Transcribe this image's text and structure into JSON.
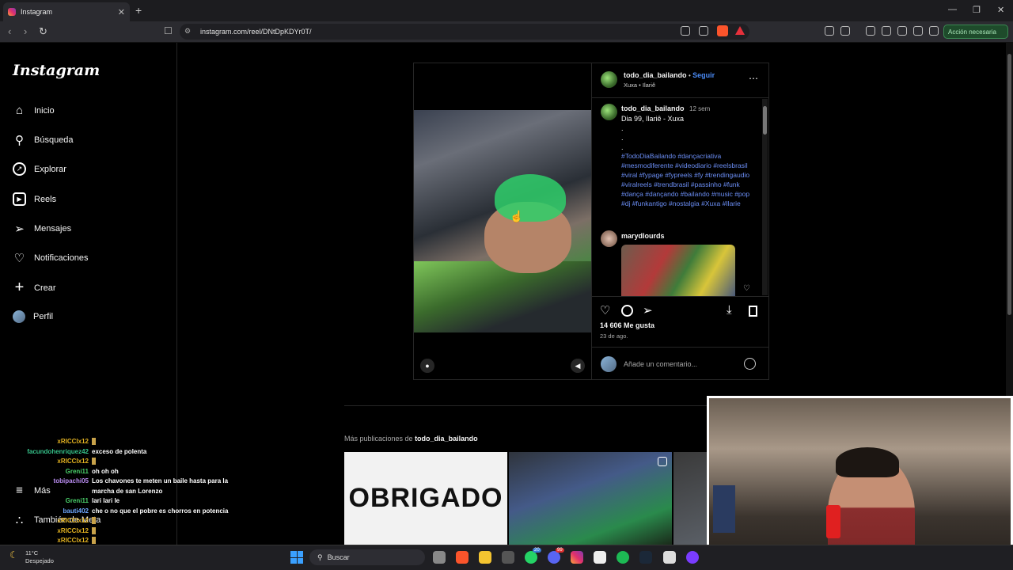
{
  "browser": {
    "tab_title": "Instagram",
    "url": "instagram.com/reel/DNtDpKDYr0T/",
    "action_button": "Acción necesaria",
    "new_tab": "+",
    "tab_close": "✕",
    "win_min": "—",
    "win_max": "❐",
    "win_close": "✕"
  },
  "sidebar": {
    "logo": "Instagram",
    "items": [
      {
        "label": "Inicio",
        "icon": "home-icon"
      },
      {
        "label": "Búsqueda",
        "icon": "search-icon"
      },
      {
        "label": "Explorar",
        "icon": "compass-icon"
      },
      {
        "label": "Reels",
        "icon": "reels-icon"
      },
      {
        "label": "Mensajes",
        "icon": "send-icon"
      },
      {
        "label": "Notificaciones",
        "icon": "heart-icon"
      },
      {
        "label": "Crear",
        "icon": "plus-icon"
      },
      {
        "label": "Perfil",
        "icon": "avatar-icon"
      }
    ],
    "more": "Más",
    "meta": "También de Meta"
  },
  "post": {
    "author": "todo_dia_bailando",
    "follow": "Seguir",
    "audio": "Xuxa • Ilariê",
    "caption_author": "todo_dia_bailando",
    "caption_time": "12 sem",
    "caption_text": "Dia 99, Ilariê - Xuxa",
    "dot1": ".",
    "dot2": ".",
    "dot3": ".",
    "hashtags": "#TodoDiaBailando #dançacriativa #mesmodiferente #videodiario #reelsbrasil #viral #fypage #fypreels #fy #trendingaudio #viralreels #trendbrasil #passinho #funk #dança #dançando #bailando #music #pop #dj #funkantigo #nostalgia #Xuxa #Ilarie",
    "comment_user": "marydlourds",
    "likes": "14 606 Me gusta",
    "date": "23 de ago.",
    "comment_placeholder": "Añade un comentario..."
  },
  "more_posts": {
    "label_prefix": "Más publicaciones de ",
    "label_user": "todo_dia_bailando",
    "first_text": "OBRIGADO"
  },
  "chat": [
    {
      "user": "xRICCIx12",
      "msg": "",
      "color": "#e0b020",
      "emote": true
    },
    {
      "user": "facundohenriquez42",
      "msg": "exceso de polenta",
      "color": "#36c28a",
      "emote": false
    },
    {
      "user": "xRICCIx12",
      "msg": "",
      "color": "#e0b020",
      "emote": true
    },
    {
      "user": "Greni11",
      "msg": "oh oh oh",
      "color": "#4ad06a",
      "emote": false
    },
    {
      "user": "tobipachi05",
      "msg": "Los chavones te meten un baile hasta para la",
      "color": "#b98cf0",
      "emote": false
    },
    {
      "user": "",
      "msg": "marcha de san Lorenzo",
      "color": "#fff",
      "emote": false
    },
    {
      "user": "Greni11",
      "msg": "lari lari le",
      "color": "#4ad06a",
      "emote": false
    },
    {
      "user": "bauti402",
      "msg": "che o no que el pobre es chorros en potencia",
      "color": "#6fa8ff",
      "emote": false
    },
    {
      "user": "xRICCIx12",
      "msg": "",
      "color": "#e0b020",
      "emote": true
    },
    {
      "user": "xRICCIx12",
      "msg": "",
      "color": "#e0b020",
      "emote": true
    },
    {
      "user": "xRICCIx12",
      "msg": "",
      "color": "#e0b020",
      "emote": true
    },
    {
      "user": "Sal9deDiciembre",
      "msg": "",
      "color": "#5ee06a",
      "emote": true
    },
    {
      "user": "xRICCIx12",
      "msg": "",
      "color": "#e0b020",
      "emote": true
    }
  ],
  "taskbar": {
    "temp": "11°C",
    "weather": "Despejado",
    "search": "Buscar",
    "badge1": "20",
    "badge2": "99"
  }
}
